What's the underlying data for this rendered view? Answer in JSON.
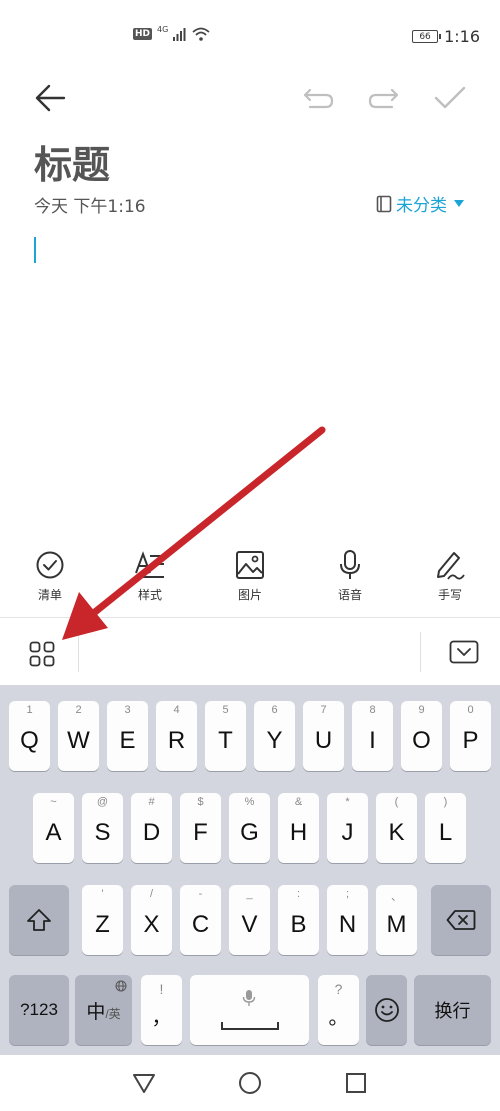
{
  "status_bar": {
    "hd_label": "HD",
    "network_label": "4G",
    "battery_level": "66",
    "time": "1:16"
  },
  "toolbar": {
    "back_icon": "arrow-left-icon",
    "undo_icon": "undo-icon",
    "redo_icon": "redo-icon",
    "save_icon": "check-icon"
  },
  "note": {
    "title": "标题",
    "date": "今天 下午1:16",
    "category": "未分类"
  },
  "tools": [
    {
      "label": "清单",
      "icon": "checklist-icon"
    },
    {
      "label": "样式",
      "icon": "text-style-icon"
    },
    {
      "label": "图片",
      "icon": "image-icon"
    },
    {
      "label": "语音",
      "icon": "microphone-icon"
    },
    {
      "label": "手写",
      "icon": "pen-icon"
    }
  ],
  "keyboard_bar": {
    "grid_icon": "grid-icon",
    "collapse_icon": "keyboard-collapse-icon"
  },
  "keyboard": {
    "row1": [
      {
        "key": "Q",
        "sub": "1"
      },
      {
        "key": "W",
        "sub": "2"
      },
      {
        "key": "E",
        "sub": "3"
      },
      {
        "key": "R",
        "sub": "4"
      },
      {
        "key": "T",
        "sub": "5"
      },
      {
        "key": "Y",
        "sub": "6"
      },
      {
        "key": "U",
        "sub": "7"
      },
      {
        "key": "I",
        "sub": "8"
      },
      {
        "key": "O",
        "sub": "9"
      },
      {
        "key": "P",
        "sub": "0"
      }
    ],
    "row2": [
      {
        "key": "A",
        "sub": "~"
      },
      {
        "key": "S",
        "sub": "@"
      },
      {
        "key": "D",
        "sub": "#"
      },
      {
        "key": "F",
        "sub": "$"
      },
      {
        "key": "G",
        "sub": "%"
      },
      {
        "key": "H",
        "sub": "&"
      },
      {
        "key": "J",
        "sub": "*"
      },
      {
        "key": "K",
        "sub": "("
      },
      {
        "key": "L",
        "sub": ")"
      }
    ],
    "row3": [
      {
        "key": "Z",
        "sub": "'"
      },
      {
        "key": "X",
        "sub": "/"
      },
      {
        "key": "C",
        "sub": "-"
      },
      {
        "key": "V",
        "sub": "_"
      },
      {
        "key": "B",
        "sub": ":"
      },
      {
        "key": "N",
        "sub": ";"
      },
      {
        "key": "M",
        "sub": "、"
      }
    ],
    "symbols_label": "?123",
    "lang_main": "中",
    "lang_sub": "/英",
    "comma_key": "，",
    "comma_sub": "!",
    "period_key": "。",
    "period_sub": "?",
    "enter_label": "换行"
  },
  "colors": {
    "accent": "#1ba4d6",
    "arrow": "#c8262a",
    "keyboard_bg": "#d3d6de"
  }
}
